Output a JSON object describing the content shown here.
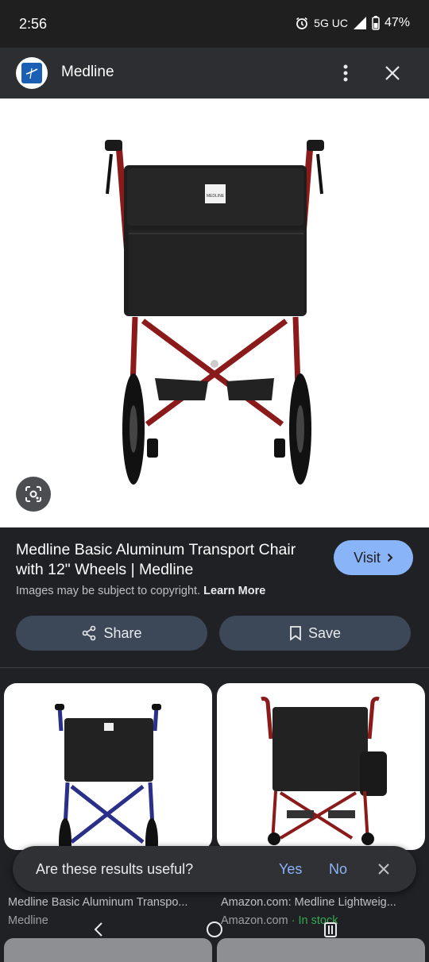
{
  "status": {
    "time": "2:56",
    "network": "5G UC",
    "battery": "47%"
  },
  "header": {
    "site_name": "Medline",
    "icons": {
      "logo": "medline-logo",
      "more": "more-vert-icon",
      "close": "close-icon"
    }
  },
  "hero": {
    "image": "red-black-transport-wheelchair",
    "logo_text": "MEDLINE"
  },
  "result": {
    "title": "Medline Basic Aluminum Transport Chair with 12\" Wheels | Medline",
    "visit_label": "Visit",
    "copyright": "Images may be subject to copyright.",
    "learn_more": "Learn More",
    "share_label": "Share",
    "save_label": "Save"
  },
  "related": [
    {
      "caption": "Medline Basic Aluminum Transpo...",
      "source": "Medline",
      "image": "blue-transport-wheelchair"
    },
    {
      "caption": "Amazon.com: Medline Lightweig...",
      "source": "Amazon.com",
      "stock": " · In stock",
      "image": "red-transport-wheelchair-with-bag"
    }
  ],
  "feedback": {
    "question": "Are these results useful?",
    "yes": "Yes",
    "no": "No"
  },
  "colors": {
    "background": "#202124",
    "accent": "#8ab4f8",
    "pill": "#3c4758",
    "stock": "#34a853",
    "frame_red": "#8b1a1a",
    "frame_blue": "#2a2f8a"
  }
}
